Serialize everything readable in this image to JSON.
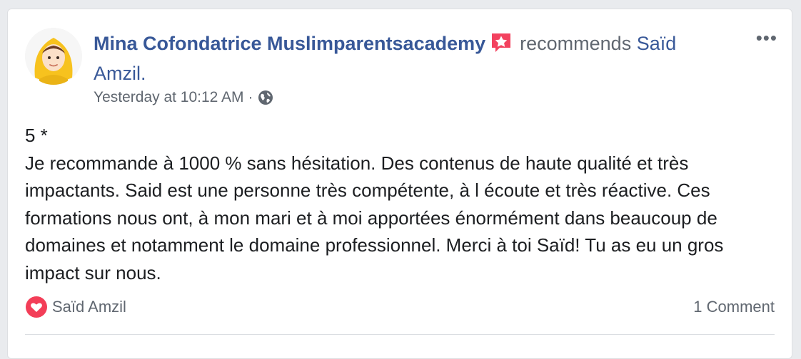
{
  "post": {
    "author": "Mina Cofondatrice Muslimparentsacademy",
    "verb": "recommends",
    "recommended_page": "Saïd Amzil.",
    "timestamp": "Yesterday at 10:12 AM",
    "separator": "·",
    "privacy_icon": "globe-icon",
    "more_label": "•••",
    "body_lines": [
      "5 *",
      "Je recommande à 1000 % sans hésitation. Des contenus de haute qualité et très impactants. Said est une personne très compétente, à l écoute et très réactive. Ces formations nous ont, à mon mari et à moi apportées énormément dans beaucoup de domaines et notamment le domaine professionnel. Merci à toi Saïd! Tu as eu un gros impact sur nous."
    ],
    "reaction_icon": "love-reaction-icon",
    "reaction_name": "Saïd Amzil",
    "comment_count": "1 Comment"
  },
  "colors": {
    "link": "#385898",
    "secondary_text": "#606770",
    "primary_text": "#1c1e21",
    "recommend_badge": "#f3425f",
    "love_reaction": "#f33e58"
  }
}
